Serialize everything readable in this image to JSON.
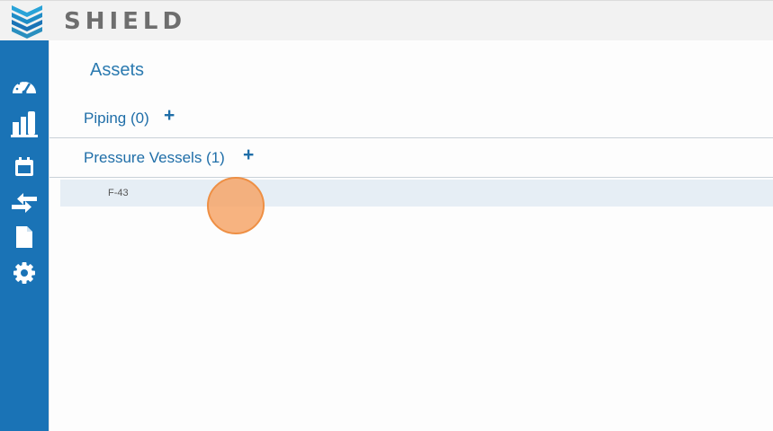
{
  "app": {
    "brand": "SHIELD"
  },
  "colors": {
    "sidebar": "#1a73b6",
    "accent": "#1f6ea8",
    "selected_row": "#e6eef5"
  },
  "sidebar": {
    "items": [
      {
        "icon": "dashboard-gauge-icon"
      },
      {
        "icon": "plant-facility-icon"
      },
      {
        "icon": "calendar-icon"
      },
      {
        "icon": "transfer-arrows-icon"
      },
      {
        "icon": "document-icon"
      },
      {
        "icon": "settings-gear-icon"
      }
    ]
  },
  "main": {
    "title": "Assets",
    "sections": [
      {
        "label": "Piping (0)",
        "add": "+"
      },
      {
        "label": "Pressure Vessels (1)",
        "add": "+"
      }
    ],
    "pressure_vessels": [
      {
        "label": "F-43"
      }
    ]
  }
}
